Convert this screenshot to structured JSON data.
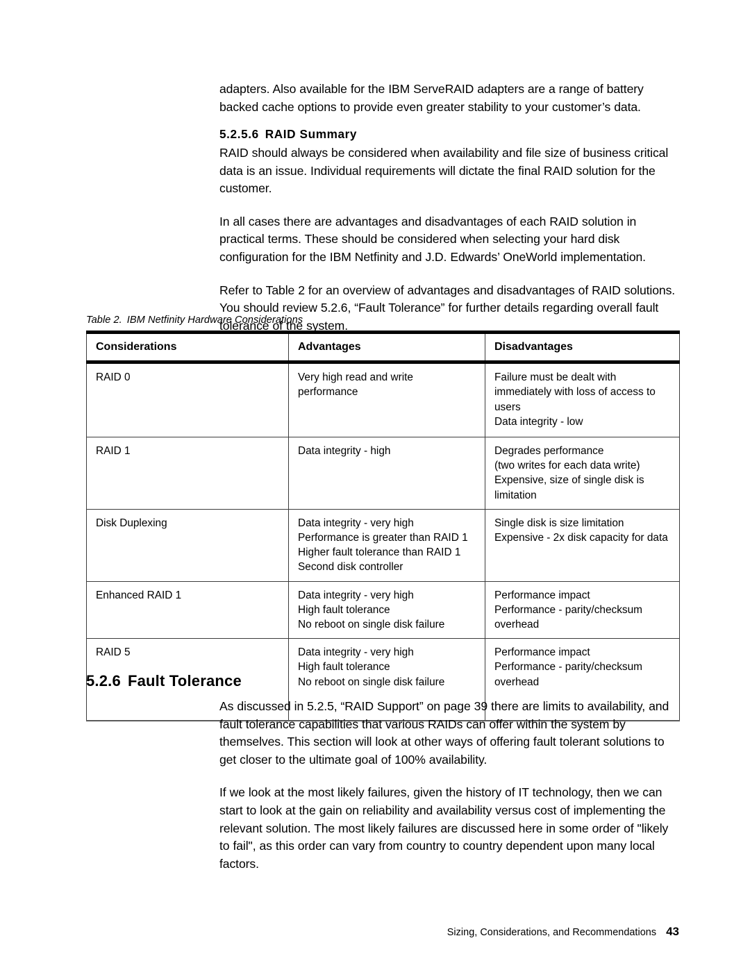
{
  "document": {
    "paragraphs_top": [
      "adapters. Also available for the IBM ServeRAID adapters are a range of battery backed cache options to provide even greater stability to your customer’s data."
    ],
    "subsection": {
      "number": "5.2.5.6",
      "title": "RAID Summary",
      "paragraphs": [
        "RAID should always be considered when availability and file size of business critical data is an issue. Individual requirements will dictate the final RAID solution for the customer.",
        "In all cases there are advantages and disadvantages of each RAID solution in practical terms. These should be considered when selecting your hard disk configuration for the IBM Netfinity and J.D. Edwards’ OneWorld implementation.",
        "Refer to Table 2 for an overview of advantages and disadvantages of RAID solutions. You should review 5.2.6, “Fault Tolerance”  for further details regarding overall fault tolerance of the system."
      ]
    },
    "table": {
      "caption_number": "Table 2.",
      "caption_title": "IBM Netfinity Hardware Considerations",
      "headers": [
        "Considerations",
        "Advantages",
        "Disadvantages"
      ],
      "rows": [
        {
          "consideration": "RAID 0",
          "advantages": "Very high read and write\nperformance",
          "disadvantages": "Failure must be dealt with\nimmediately with loss of access to\nusers\nData integrity - low"
        },
        {
          "consideration": "RAID 1",
          "advantages": "Data integrity - high",
          "disadvantages": "Degrades performance\n(two writes for each data write)\nExpensive, size of single disk is\nlimitation"
        },
        {
          "consideration": "Disk Duplexing",
          "advantages": "Data integrity - very high\nPerformance is greater than RAID 1\nHigher fault tolerance than RAID 1\nSecond disk controller",
          "disadvantages": "Single disk is size limitation\nExpensive - 2x disk capacity for data"
        },
        {
          "consideration": "Enhanced RAID 1",
          "advantages": "Data integrity - very high\nHigh fault tolerance\nNo reboot on single disk failure",
          "disadvantages": "Performance impact\nPerformance - parity/checksum\noverhead"
        },
        {
          "consideration": "RAID 5",
          "advantages": "Data integrity - very high\nHigh fault tolerance\nNo reboot on single disk failure",
          "disadvantages": "Performance impact\nPerformance - parity/checksum\noverhead"
        }
      ]
    },
    "section": {
      "number": "5.2.6",
      "title": "Fault Tolerance",
      "paragraphs": [
        "As discussed in 5.2.5, “RAID Support” on page 39 there are limits to availability, and fault tolerance capabilities that various RAIDs can offer within the system by themselves. This section will look at other ways of offering fault tolerant solutions to get closer to the ultimate goal of 100% availability.",
        "If we look at the most likely failures, given the history of IT technology, then we can start to look at the gain on reliability and availability versus cost of implementing the relevant solution. The most likely failures are discussed here in some order of \"likely to fail\", as this order can vary from country to country dependent upon many local factors."
      ]
    },
    "footer": {
      "running_title": "Sizing, Considerations, and Recommendations",
      "page_number": "43"
    }
  }
}
